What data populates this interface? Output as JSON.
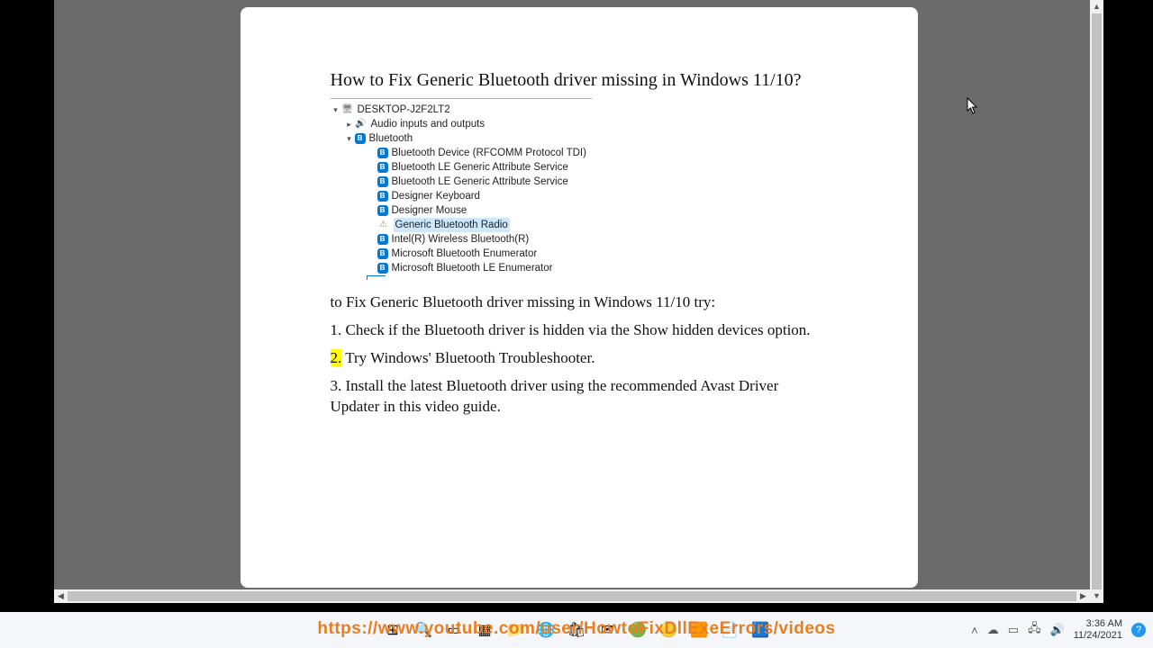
{
  "document": {
    "title": "How to Fix Generic Bluetooth driver missing in Windows 11/10?",
    "intro": "to Fix Generic Bluetooth driver missing in Windows 11/10 try:",
    "step1": "1. Check if the Bluetooth driver is hidden via the Show hidden devices option.",
    "step2_num": "2.",
    "step2_text": " Try Windows' Bluetooth Troubleshooter.",
    "step3": "3. Install the latest Bluetooth driver using the recommended Avast Driver Updater in this video guide."
  },
  "device_tree": {
    "root": "DESKTOP-J2F2LT2",
    "audio": "Audio inputs and outputs",
    "bluetooth": "Bluetooth",
    "items": [
      "Bluetooth Device (RFCOMM Protocol TDI)",
      "Bluetooth LE Generic Attribute Service",
      "Bluetooth LE Generic Attribute Service",
      "Designer Keyboard",
      "Designer Mouse",
      "Generic Bluetooth Radio",
      "Intel(R) Wireless Bluetooth(R)",
      "Microsoft Bluetooth Enumerator",
      "Microsoft Bluetooth LE Enumerator"
    ]
  },
  "overlay_url": "https://www.youtube.com/user/HowtoFixDllExeErrors/videos",
  "tray": {
    "time": "3:36 AM",
    "date": "11/24/2021"
  }
}
